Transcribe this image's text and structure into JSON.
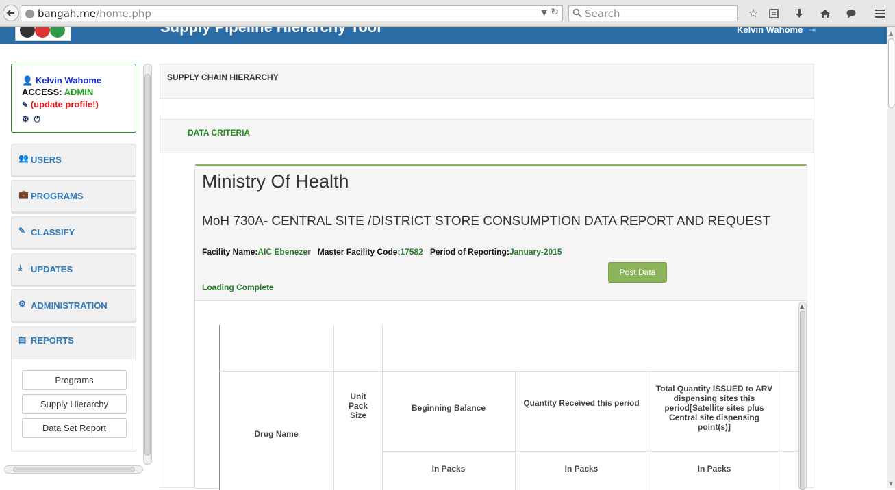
{
  "browser": {
    "url_host": "bangah.me",
    "url_path": "/home.php",
    "search_placeholder": "Search"
  },
  "header": {
    "app_title": "Supply Pipeline Hierarchy Tool",
    "user_name": "Kelvin Wahome"
  },
  "profile": {
    "name": "Kelvin Wahome",
    "access_label": "ACCESS:",
    "access_role": "ADMIN",
    "update_link": "(update profile!)"
  },
  "sidebar": {
    "items": [
      {
        "label": "USERS",
        "icon": "users-icon"
      },
      {
        "label": "PROGRAMS",
        "icon": "briefcase-icon"
      },
      {
        "label": "CLASSIFY",
        "icon": "edit-icon"
      },
      {
        "label": "UPDATES",
        "icon": "download-icon"
      },
      {
        "label": "ADMINISTRATION",
        "icon": "cogs-icon"
      },
      {
        "label": "REPORTS",
        "icon": "newspaper-icon"
      }
    ],
    "report_buttons": [
      "Programs",
      "Supply Hierarchy",
      "Data Set Report"
    ]
  },
  "main": {
    "heading": "SUPPLY CHAIN HIERARCHY",
    "criteria_label": "DATA CRITERIA",
    "ministry": "Ministry Of Health",
    "report_title": "MoH 730A- CENTRAL SITE /DISTRICT STORE CONSUMPTION DATA REPORT AND REQUEST",
    "facility_name_label": "Facility Name:",
    "facility_name": "AIC Ebenezer",
    "mfl_label": "Master Facility Code:",
    "mfl_code": "17582",
    "period_label": "Period of Reporting:",
    "period": "January-2015",
    "post_button": "Post Data",
    "loading_status": "Loading Complete"
  },
  "table": {
    "columns": {
      "drug_name": "Drug Name",
      "unit_pack": "Unit Pack Size",
      "beginning_balance": "Beginning Balance",
      "quantity_received": "Quantity Received this period",
      "total_issued": "Total Quantity ISSUED to ARV dispensing sites this period[Satellite sites plus Central site dispensing point(s)]"
    },
    "sub_headers": [
      "In Packs",
      "In Packs",
      "In Packs"
    ]
  },
  "colors": {
    "header_blue": "#2a6ca6",
    "link_blue": "#2f79b8",
    "accent_green": "#8bb35a",
    "status_green": "#2b7a2b",
    "admin_green": "#21a021",
    "alert_red": "#e21818"
  }
}
